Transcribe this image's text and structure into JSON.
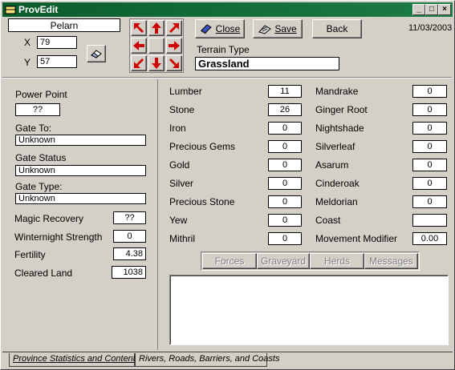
{
  "window": {
    "title": "ProvEdit",
    "minimize": "_",
    "maximize": "□",
    "close": "×"
  },
  "header": {
    "province_name": "Pelarn",
    "x_label": "X",
    "x_value": "79",
    "y_label": "Y",
    "y_value": "57",
    "close_label": "Close",
    "save_label": "Save",
    "back_label": "Back",
    "date": "11/03/2003",
    "terrain_label": "Terrain Type",
    "terrain_value": "Grassland"
  },
  "left": {
    "power_point_label": "Power Point",
    "power_point_value": "??",
    "gate_to_label": "Gate To:",
    "gate_to_value": "Unknown",
    "gate_status_label": "Gate Status",
    "gate_status_value": "Unknown",
    "gate_type_label": "Gate Type:",
    "gate_type_value": "Unknown",
    "magic_recovery_label": "Magic Recovery",
    "magic_recovery_value": "??",
    "winternight_label": "Winternight Strength",
    "winternight_value": "0",
    "fertility_label": "Fertility",
    "fertility_value": "4.38",
    "cleared_land_label": "Cleared Land",
    "cleared_land_value": "1038"
  },
  "resources_col1": [
    {
      "label": "Lumber",
      "value": "11"
    },
    {
      "label": "Stone",
      "value": "26"
    },
    {
      "label": "Iron",
      "value": "0"
    },
    {
      "label": "Precious Gems",
      "value": "0"
    },
    {
      "label": "Gold",
      "value": "0"
    },
    {
      "label": "Silver",
      "value": "0"
    },
    {
      "label": "Precious Stone",
      "value": "0"
    },
    {
      "label": "Yew",
      "value": "0"
    },
    {
      "label": "Mithril",
      "value": "0"
    }
  ],
  "resources_col2": [
    {
      "label": "Mandrake",
      "value": "0"
    },
    {
      "label": "Ginger Root",
      "value": "0"
    },
    {
      "label": "Nightshade",
      "value": "0"
    },
    {
      "label": "Silverleaf",
      "value": "0"
    },
    {
      "label": "Asarum",
      "value": "0"
    },
    {
      "label": "Cinderoak",
      "value": "0"
    },
    {
      "label": "Meldorian",
      "value": "0"
    },
    {
      "label": "Coast",
      "value": ""
    },
    {
      "label": "Movement Modifier",
      "value": "0.00"
    }
  ],
  "subtabs": [
    "Forces",
    "Graveyard",
    "Herds",
    "Messages"
  ],
  "tabs": [
    "Province Statistics and Contents",
    "Rivers, Roads, Barriers, and Coasts"
  ]
}
